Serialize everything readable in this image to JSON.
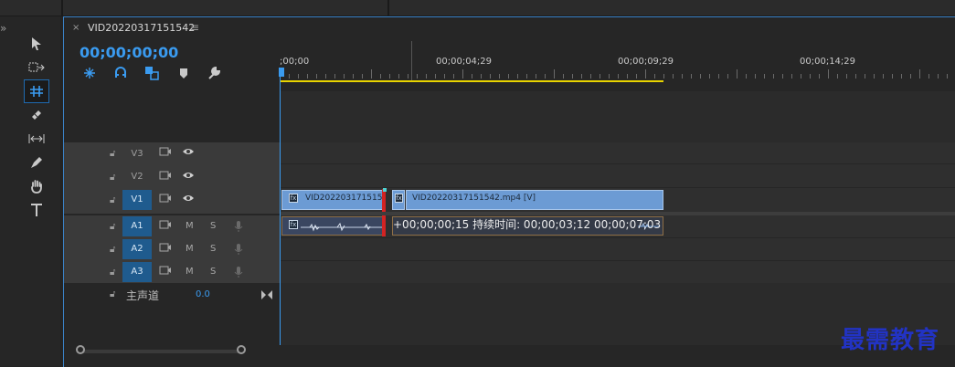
{
  "sequence_tab": {
    "close_glyph": "×",
    "title": "VID20220317151542",
    "menu_glyph": "≡"
  },
  "timecode": "00;00;00;00",
  "ruler": {
    "labels": [
      ";00;00",
      "00;00;04;29",
      "00;00;09;29",
      "00;00;14;29"
    ]
  },
  "tools": [
    {
      "name": "selection-tool",
      "glyph": "▶"
    },
    {
      "name": "track-select-forward-tool",
      "glyph": "⇢"
    },
    {
      "name": "ripple-edit-tool",
      "glyph": "⧺"
    },
    {
      "name": "razor-tool",
      "glyph": "◈"
    },
    {
      "name": "slip-tool",
      "glyph": "↔"
    },
    {
      "name": "pen-tool",
      "glyph": "✒"
    },
    {
      "name": "hand-tool",
      "glyph": "✋"
    },
    {
      "name": "type-tool",
      "glyph": "T"
    }
  ],
  "tracks": {
    "video": [
      {
        "label": "V3"
      },
      {
        "label": "V2"
      },
      {
        "label": "V1"
      }
    ],
    "audio": [
      {
        "label": "A1",
        "m": "M",
        "s": "S"
      },
      {
        "label": "A2",
        "m": "M",
        "s": "S"
      },
      {
        "label": "A3",
        "m": "M",
        "s": "S"
      }
    ],
    "master": {
      "label": "主声道",
      "value": "0.0"
    }
  },
  "clips": {
    "v1_left": "VID202203171515",
    "v1_right": "VID20220317151542.mp4 [V]"
  },
  "edit_tooltip": "+00;00;00;15 持续时间: 00;00;03;12 00;00;07;03",
  "watermark": "最需教育",
  "colors": {
    "accent": "#3a9bf0",
    "work_area": "#e8d400",
    "video_clip": "#6c9bd4",
    "audio_clip": "#3a4660",
    "track_active": "#1f5b8e"
  }
}
